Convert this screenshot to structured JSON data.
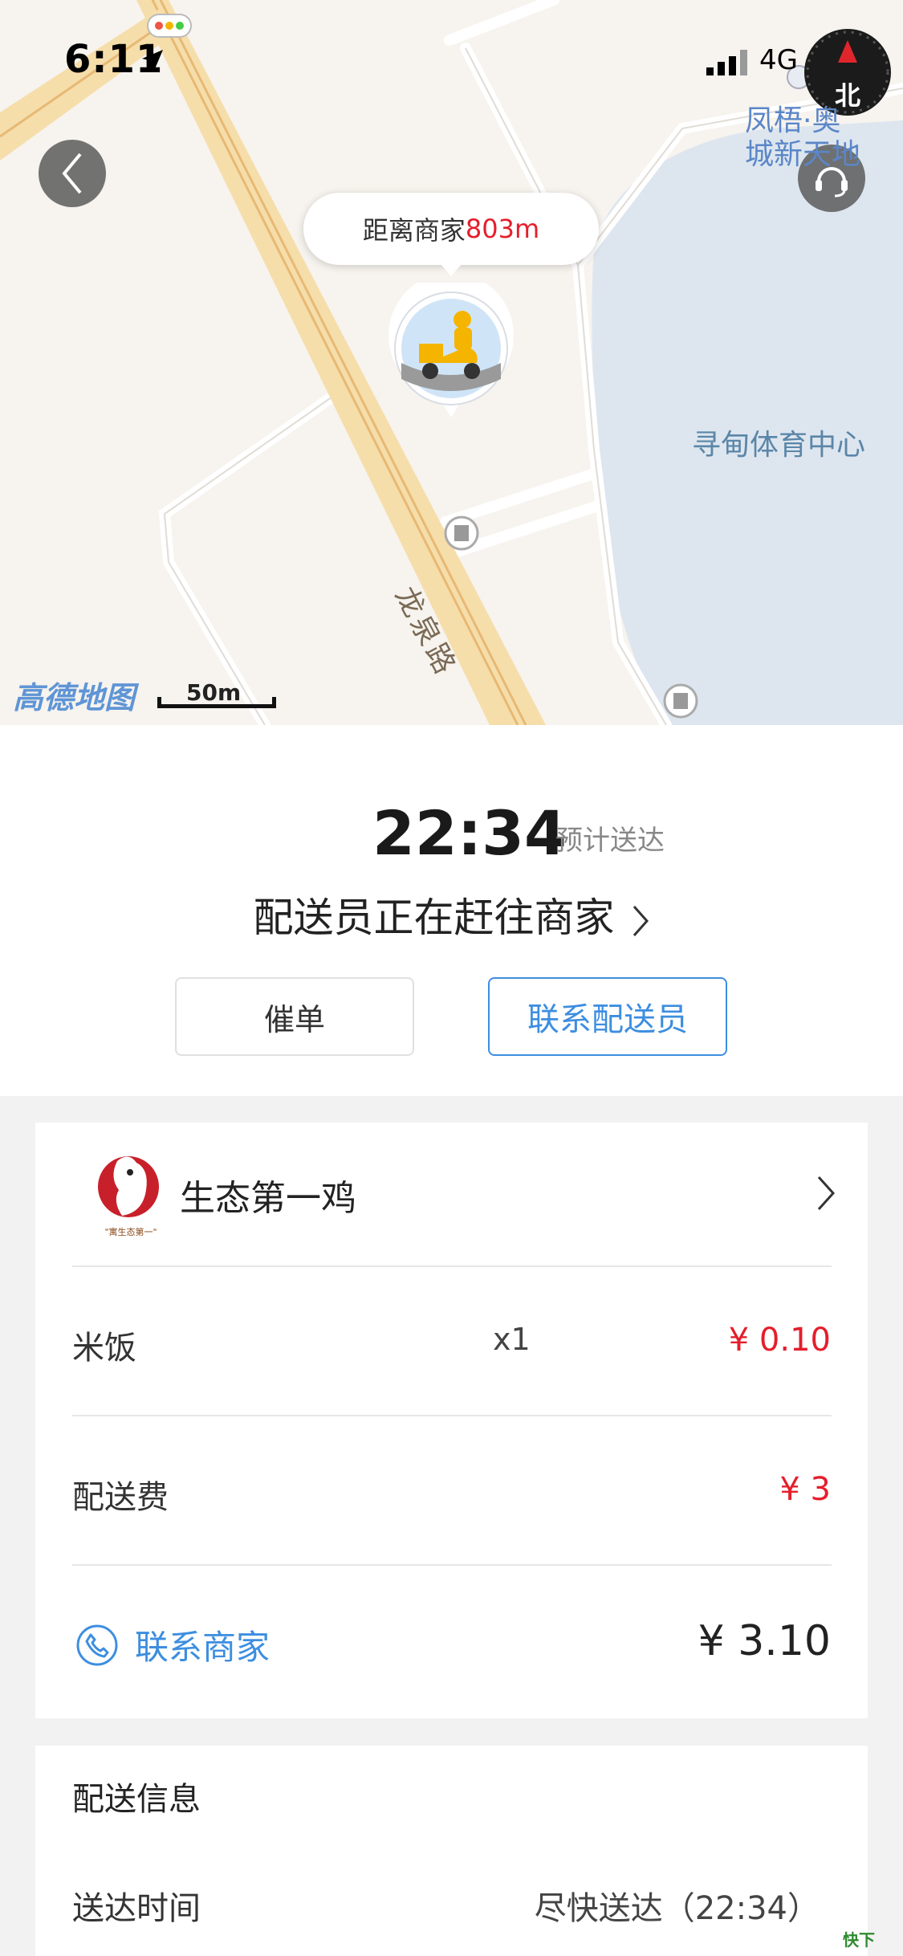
{
  "status_bar": {
    "time": "6:11",
    "network": "4G"
  },
  "map": {
    "compass_label": "北",
    "poi_fengwu": "凤梧·奥城新天地",
    "poi_sport_center": "寻甸体育中心",
    "road_label": "龙泉路",
    "distance_prefix": "距离商家",
    "distance_value": "803m",
    "provider": "高德地图",
    "scale": "50m"
  },
  "eta": {
    "time": "22:34",
    "label": "预计送达",
    "status": "配送员正在赶往商家",
    "urge_button": "催单",
    "contact_rider_button": "联系配送员"
  },
  "order": {
    "store_name": "生态第一鸡",
    "items": [
      {
        "name": "米饭",
        "qty": "x1",
        "price": "¥ 0.10"
      }
    ],
    "delivery_fee_label": "配送费",
    "delivery_fee": "¥ 3",
    "contact_store": "联系商家",
    "total": "¥ 3.10"
  },
  "delivery_info": {
    "title": "配送信息",
    "time_label": "送达时间",
    "time_value": "尽快送达（22:34）"
  },
  "colors": {
    "accent": "#3d8ee0",
    "price_red": "#e51e2b"
  }
}
